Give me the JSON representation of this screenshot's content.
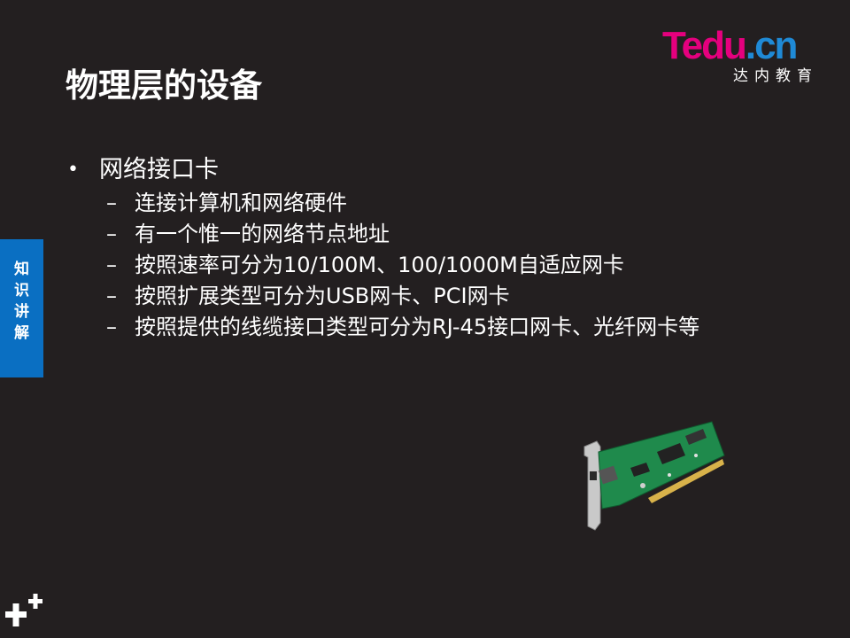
{
  "logo": {
    "brand": "Tedu",
    "suffix": ".cn",
    "subtitle": "达内教育"
  },
  "title": "物理层的设备",
  "bullet": {
    "text": "网络接口卡",
    "items": [
      "连接计算机和网络硬件",
      "有一个惟一的网络节点地址",
      "按照速率可分为10/100M、100/1000M自适应网卡",
      "按照扩展类型可分为USB网卡、PCI网卡",
      "按照提供的线缆接口类型可分为RJ-45接口网卡、光纤网卡等"
    ]
  },
  "side_tab": "知识讲解",
  "colors": {
    "background": "#231f20",
    "brand_magenta": "#e5007e",
    "brand_blue": "#1f8ad6",
    "side_tab": "#0a6fc2"
  },
  "icons": {
    "corner": "plus-decoration-icon"
  }
}
